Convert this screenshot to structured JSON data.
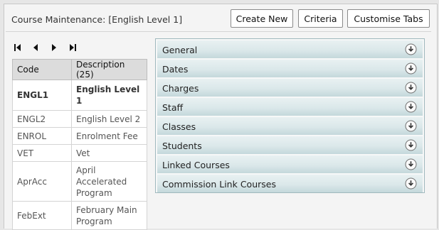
{
  "header": {
    "title": "Course Maintenance: [English Level 1]",
    "buttons": {
      "create_new": "Create New",
      "criteria": "Criteria",
      "customise_tabs": "Customise Tabs"
    }
  },
  "pager": {
    "icons": [
      "first-page-icon",
      "previous-page-icon",
      "next-page-icon",
      "last-page-icon"
    ]
  },
  "table": {
    "columns": [
      "Code",
      "Description (25)"
    ],
    "rows": [
      {
        "code": "ENGL1",
        "description": "English Level 1",
        "selected": true
      },
      {
        "code": "ENGL2",
        "description": "English Level 2"
      },
      {
        "code": "ENROL",
        "description": "Enrolment Fee"
      },
      {
        "code": "VET",
        "description": "Vet"
      },
      {
        "code": "AprAcc",
        "description": "April Accelerated Program"
      },
      {
        "code": "FebExt",
        "description": "February Main Program"
      }
    ]
  },
  "sections": [
    "General",
    "Dates",
    "Charges",
    "Staff",
    "Classes",
    "Students",
    "Linked Courses",
    "Commission Link Courses"
  ],
  "colors": {
    "section_bar": "#dbe8ea",
    "header_row": "#dcdcdc"
  }
}
